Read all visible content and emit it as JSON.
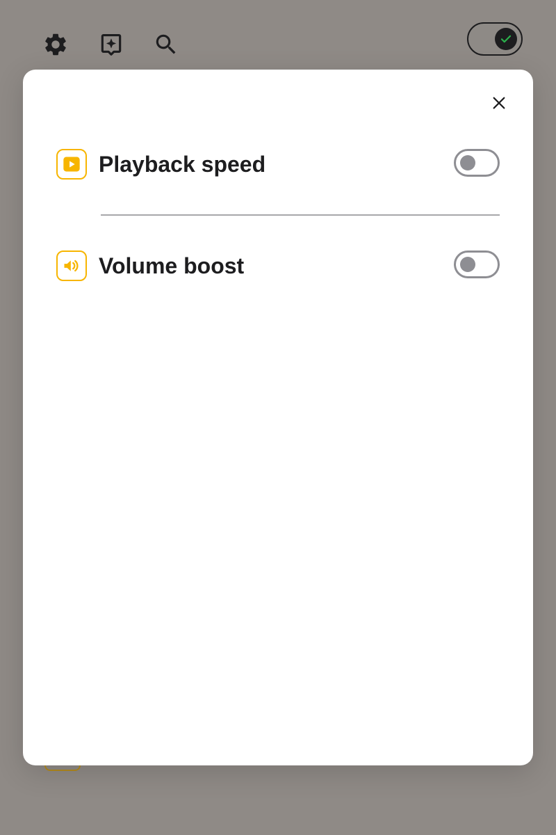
{
  "colors": {
    "backdrop": "#8f8a86",
    "sheet": "#ffffff",
    "accent": "#f7b500",
    "text": "#1d1d1f",
    "toggle_off": "#8e8e93",
    "toggle_on_check": "#2bb24c"
  },
  "top_bar": {
    "icons": [
      "gear-icon",
      "sparkle-bookmark-icon",
      "search-icon"
    ],
    "master_toggle": {
      "state": "on",
      "icon": "check-icon"
    }
  },
  "sheet": {
    "close_icon": "close-icon",
    "items": [
      {
        "label": "Playback speed",
        "icon": "play-icon",
        "enabled": false
      },
      {
        "label": "Volume boost",
        "icon": "speaker-icon",
        "enabled": false
      }
    ]
  }
}
